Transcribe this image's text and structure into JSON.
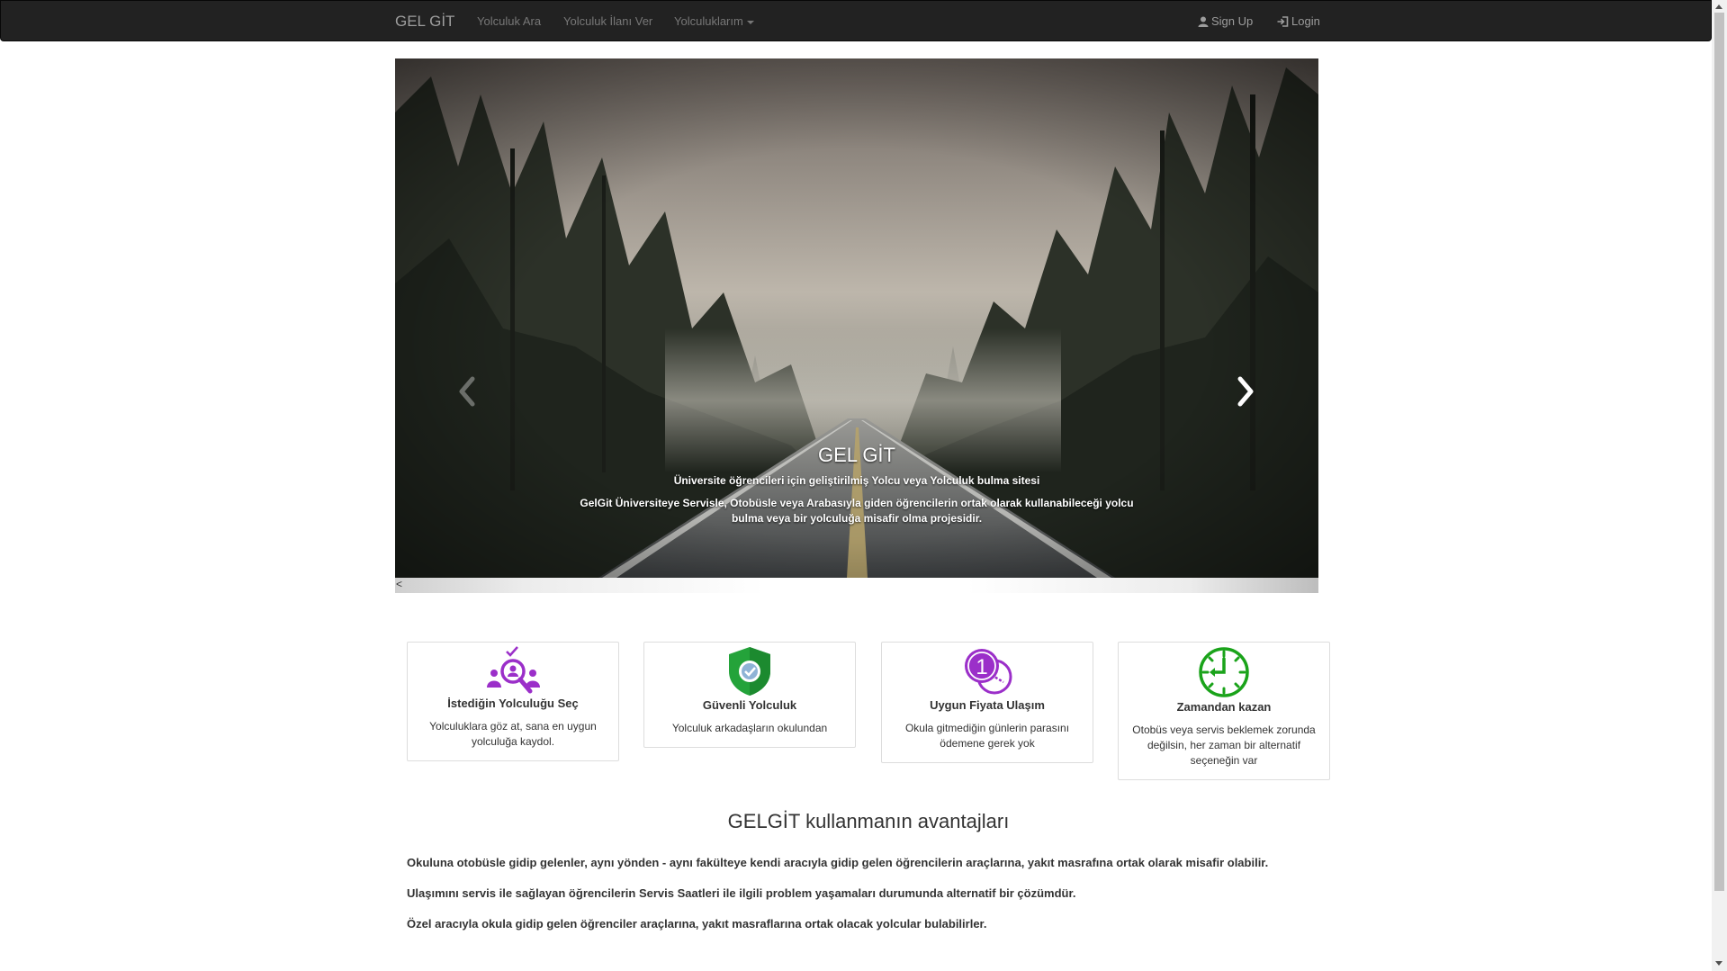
{
  "navbar": {
    "brand": "GEL GİT",
    "links": [
      "Yolculuk Ara",
      "Yolculuk İlanı Ver"
    ],
    "dropdown_label": "Yolculuklarım",
    "signup": "Sign Up",
    "login": "Login"
  },
  "carousel": {
    "title": "GEL GİT",
    "subtitle": "Üniversite öğrencileri için geliştirilmiş Yolcu veya Yolculuk bulma sitesi",
    "description": "GelGit Üniversiteye Servisle, Otobüsle veya Arabasıyla giden öğrencilerin ortak olarak kullanabileceği yolcu bulma veya bir yolculuğa misafir olma projesidir.",
    "strip_arrow": "<"
  },
  "features": [
    {
      "title": "İstediğin Yolculuğu Seç",
      "text": "Yolculuklara göz at, sana en uygun yolculuğa kaydol.",
      "icon": "search-people-icon"
    },
    {
      "title": "Güvenli Yolculuk",
      "text": "Yolculuk arkadaşların okulundan",
      "icon": "shield-check-icon"
    },
    {
      "title": "Uygun Fiyata Ulaşım",
      "text": "Okula gitmediğin günlerin parasını ödemene gerek yok",
      "icon": "coin-icon",
      "coin_number": "1"
    },
    {
      "title": "Zamandan kazan",
      "text": "Otobüs veya servis beklemek zorunda değilsin, her zaman bir alternatif seçeneğin var",
      "icon": "clock-icon"
    }
  ],
  "advantages": {
    "title": "GELGİT kullanmanın avantajları",
    "items": [
      "Okuluna otobüsle gidip gelenler, aynı yönden - aynı fakülteye kendi aracıyla gidip gelen öğrencilerin araçlarına, yakıt masrafına ortak olarak misafir olabilir.",
      "Ulaşımını servis ile sağlayan öğrencilerin Servis Saatleri ile ilgili problem yaşamaları durumunda alternatif bir çözümdür.",
      "Özel aracıyla okula gidip gelen öğrenciler araçlarına, yakıt masraflarına ortak olacak yolcular bulabilirler."
    ]
  },
  "colors": {
    "navbar_bg": "#222222",
    "purple": "#9b2fc9",
    "green": "#1aa31a"
  }
}
